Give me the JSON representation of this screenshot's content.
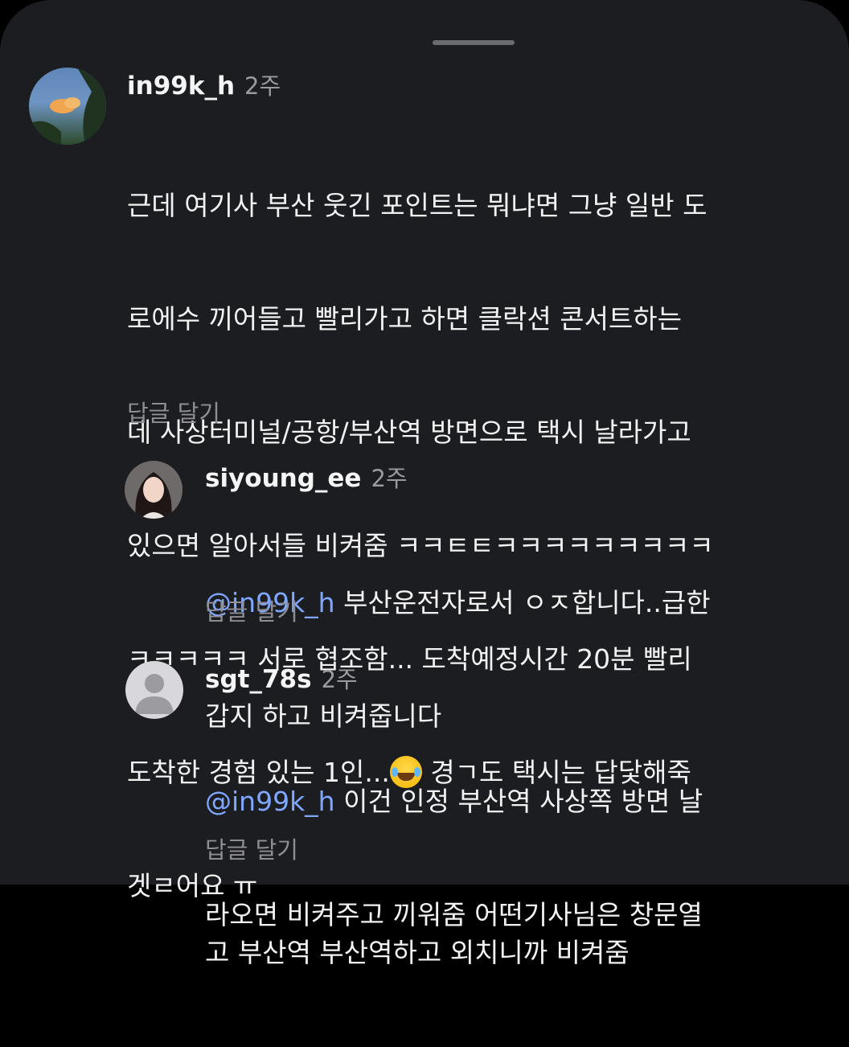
{
  "comments": [
    {
      "username": "in99k_h",
      "time": "2주",
      "lines": [
        "근데 여기사 부산 웃긴 포인트는 뭐냐면 그냥 일반 도",
        "로에수 끼어들고 빨리가고 하면 클락션 콘서트하는",
        "데 사상터미널/공항/부산역 방면으로 택시 날라가고",
        "있으면 알아서들 비켜줌 ㅋㅋㅌㅌㅋㅋㅋㅋㅋㅋㅋㅋㅋ",
        "ㅋㅋㅋㅋㅋ 서로 협조함... 도착예정시간 20분 빨리"
      ],
      "line6_before_emoji": "도착한 경험 있는 1인...",
      "emoji": "face-with-tears-of-joy",
      "line6_after_emoji": " 경ㄱ도 택시는 답닻해죽",
      "line7": "겟ㄹ어요 ㅠ",
      "reply_label": "답글 달기"
    }
  ],
  "replies": [
    {
      "username": "siyoung_ee",
      "time": "2주",
      "mention": "@in99k_h",
      "first_line_rest": " 부산운전자로서 ㅇㅈ합니다..급한",
      "more_lines": "갑지 하고 비켜줍니다",
      "reply_label": "답글 달기"
    },
    {
      "username": "sgt_78s",
      "time": "2주",
      "mention": "@in99k_h",
      "first_line_rest": " 이건 인정 부산역 사상쪽 방면 날",
      "more_lines": "라오면 비켜주고 끼워줌 어떤기사님은 창문열\n고 부산역 부산역하고 외치니까 비켜줌",
      "reply_label": "답글 달기"
    }
  ],
  "colors": {
    "background": "#1c1d21",
    "mention": "#7fa7ff",
    "muted": "#8e8e93"
  }
}
